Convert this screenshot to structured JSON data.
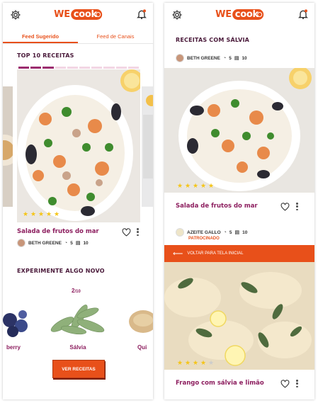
{
  "brand": {
    "we": "WE",
    "cook": "cook",
    "accent": "#e8501a",
    "title_color": "#8c1d5e"
  },
  "left": {
    "tabs": [
      {
        "label": "Feed Sugerido",
        "active": true
      },
      {
        "label": "Feed de Canais",
        "active": false
      }
    ],
    "top10_title": "TOP 10 RECEITAS",
    "progress": {
      "total": 10,
      "current": 1
    },
    "featured": {
      "title": "Salada de frutos do mar",
      "stars": 5,
      "author": "BETH GREENE",
      "stat_a": "5",
      "stat_b": "10"
    },
    "try_title": "EXPERIMENTE ALGO NOVO",
    "counter": {
      "current": "2",
      "total": "/10"
    },
    "herbs": [
      {
        "label": "berry"
      },
      {
        "label": "Sálvia"
      },
      {
        "label": "Qui"
      }
    ],
    "button_label": "VER RECEITAS"
  },
  "right": {
    "section_title": "RECEITAS COM SÁLVIA",
    "author": "BETH GREENE",
    "stat_a": "5",
    "stat_b": "10",
    "card1": {
      "title": "Salada de frutos do mar",
      "stars": 5
    },
    "sponsor": {
      "name": "AZEITE GALLO",
      "stat_a": "5",
      "stat_b": "10",
      "label": "PATROCINADO"
    },
    "banner_label": "VOLTAR PARA TELA INICIAL",
    "card2": {
      "title": "Frango com sálvia e limão",
      "stars": 4
    }
  }
}
